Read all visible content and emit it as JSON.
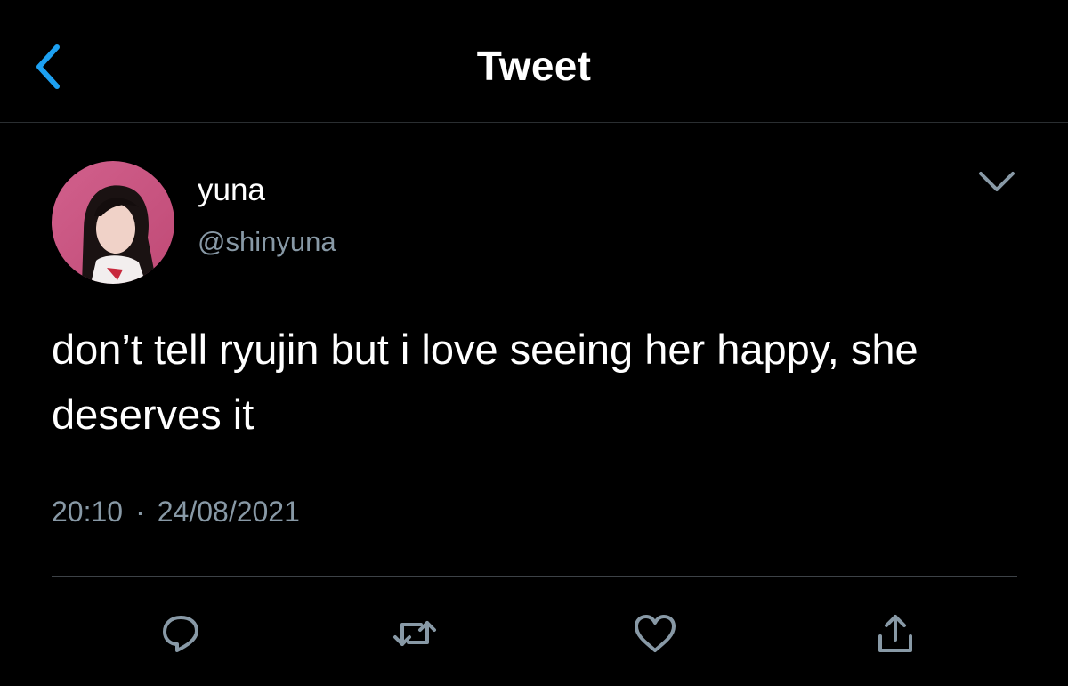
{
  "header": {
    "title": "Tweet",
    "back_icon": "chevron-left-icon"
  },
  "tweet": {
    "author": {
      "display_name": "yuna",
      "handle": "@shinyuna"
    },
    "text": "don’t tell ryujin but i love seeing her happy, she deserves it",
    "time": "20:10",
    "separator": "·",
    "date": "24/08/2021",
    "actions": [
      {
        "name": "reply",
        "icon": "reply-icon"
      },
      {
        "name": "retweet",
        "icon": "retweet-icon"
      },
      {
        "name": "like",
        "icon": "heart-icon"
      },
      {
        "name": "share",
        "icon": "share-icon"
      }
    ]
  },
  "colors": {
    "background": "#000000",
    "accent": "#1da1f2",
    "secondary_text": "#8899a6",
    "icon": "#8899a6",
    "divider": "#3d4247"
  }
}
